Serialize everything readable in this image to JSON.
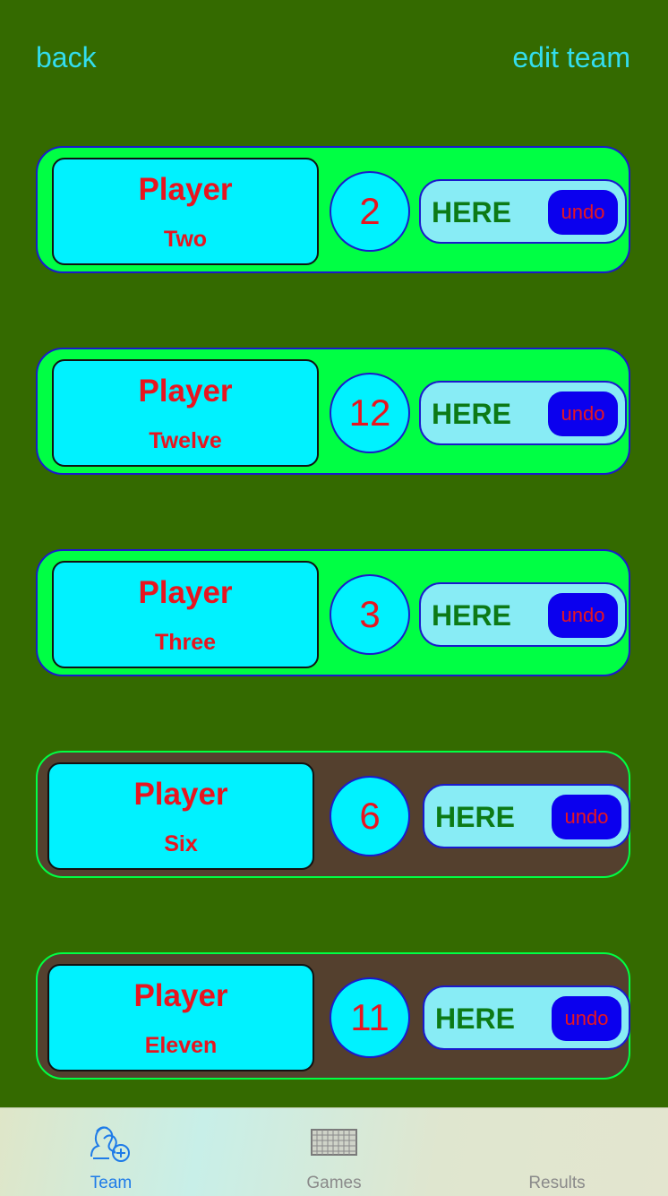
{
  "nav": {
    "back_label": "back",
    "edit_label": "edit team"
  },
  "players": [
    {
      "first": "Player",
      "second": "Two",
      "number": "2",
      "status": "present",
      "here_label": "HERE",
      "undo_label": "undo"
    },
    {
      "first": "Player",
      "second": "Twelve",
      "number": "12",
      "status": "present",
      "here_label": "HERE",
      "undo_label": "undo"
    },
    {
      "first": "Player",
      "second": "Three",
      "number": "3",
      "status": "present",
      "here_label": "HERE",
      "undo_label": "undo"
    },
    {
      "first": "Player",
      "second": "Six",
      "number": "6",
      "status": "absent",
      "here_label": "HERE",
      "undo_label": "undo"
    },
    {
      "first": "Player",
      "second": "Eleven",
      "number": "11",
      "status": "absent",
      "here_label": "HERE",
      "undo_label": "undo"
    }
  ],
  "tabs": [
    {
      "label": "Team",
      "icon": "team-add-icon",
      "active": true
    },
    {
      "label": "Games",
      "icon": "goal-net-icon",
      "active": false
    },
    {
      "label": "Results",
      "icon": "results-icon",
      "active": false
    }
  ],
  "colors": {
    "background": "#346a00",
    "present_card": "#00ff44",
    "absent_card": "#54402e",
    "name_box": "#00f2ff",
    "name_text": "#e8151f",
    "here_text": "#0c7a16",
    "undo_button": "#0b00ee",
    "nav_link": "#33ddee",
    "tab_active": "#1e7be8"
  }
}
